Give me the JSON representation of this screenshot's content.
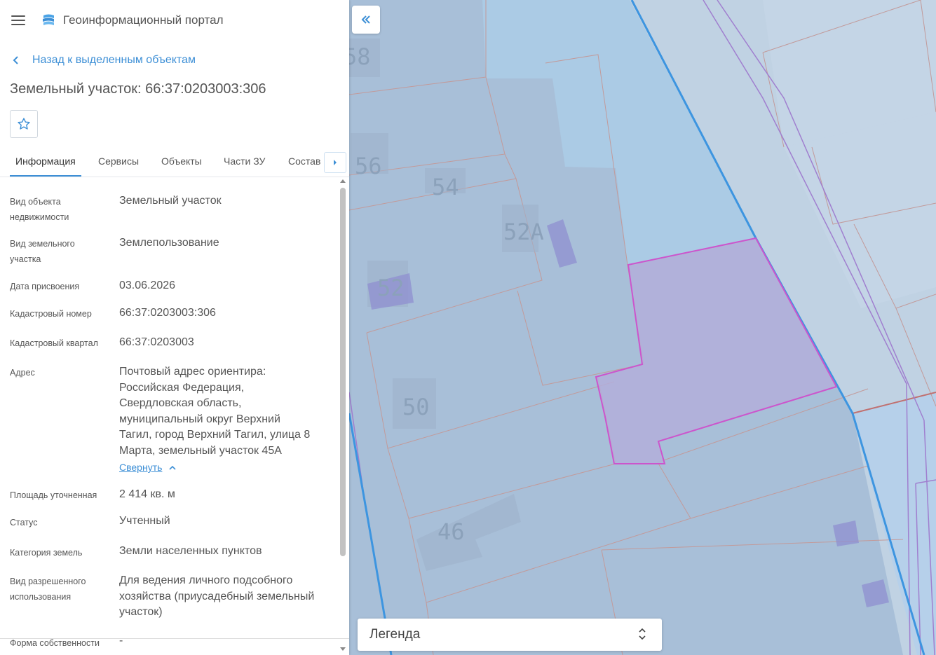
{
  "app": {
    "title": "Геоинформационный портал"
  },
  "nav": {
    "back_label": "Назад к выделенным объектам"
  },
  "object": {
    "title": "Земельный участок: 66:37:0203003:306"
  },
  "tabs": [
    {
      "label": "Информация",
      "active": true
    },
    {
      "label": "Сервисы",
      "active": false
    },
    {
      "label": "Объекты",
      "active": false
    },
    {
      "label": "Части ЗУ",
      "active": false
    },
    {
      "label": "Состав",
      "active": false
    }
  ],
  "details": {
    "object_type": {
      "label": "Вид объекта недвижимости",
      "value": "Земельный участок"
    },
    "parcel_type": {
      "label": "Вид земельного участка",
      "value": "Землепользование"
    },
    "assign_date": {
      "label": "Дата присвоения",
      "value": "03.06.2026"
    },
    "cadastral_number": {
      "label": "Кадастровый номер",
      "value": "66:37:0203003:306"
    },
    "cadastral_quarter": {
      "label": "Кадастровый квартал",
      "value": "66:37:0203003"
    },
    "address": {
      "label": "Адрес",
      "lines": [
        "Почтовый адрес ориентира:",
        "Российская Федерация,",
        "Свердловская область,",
        "муниципальный округ Верхний",
        "Тагил, город Верхний Тагил, улица 8",
        "Марта, земельный участок 45А"
      ],
      "collapse_label": "Свернуть"
    },
    "area": {
      "label": "Площадь уточненная",
      "value": "2 414 кв. м"
    },
    "status": {
      "label": "Статус",
      "value": "Учтенный"
    },
    "land_category": {
      "label": "Категория земель",
      "value": "Земли населенных пунктов"
    },
    "permitted_use": {
      "label": "Вид разрешенного использования",
      "lines": [
        "Для ведения личного подсобного",
        "хозяйства (приусадебный земельный",
        "участок)"
      ]
    },
    "ownership": {
      "label": "Форма собственности",
      "value": "-"
    }
  },
  "map": {
    "labels": [
      "58",
      "56",
      "54",
      "52А",
      "52",
      "50",
      "46"
    ],
    "legend_label": "Легенда",
    "colors": {
      "parcel_fill": "#a8bfd8",
      "selected_fill": "#b3aedb",
      "selected_stroke": "#cc55cc",
      "road_fill": "#c0d2e3",
      "blue_line": "#3d95e0",
      "building": "#8f8fd0"
    }
  },
  "icons": [
    "menu-icon",
    "logo-icon",
    "chevron-left-icon",
    "star-icon",
    "caret-right-icon",
    "double-chevron-left-icon",
    "chevron-up-icon",
    "sort-arrows-icon"
  ]
}
